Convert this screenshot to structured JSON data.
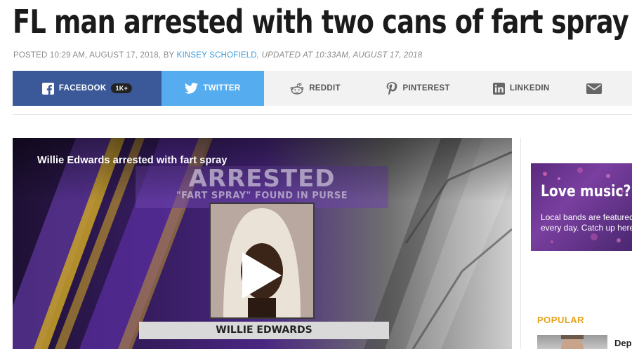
{
  "article": {
    "headline": "FL man arrested with two cans of fart spray",
    "byline_prefix": "POSTED 10:29 AM, AUGUST 17, 2018, BY ",
    "author": "KINSEY SCHOFIELD",
    "updated": ", UPDATED AT 10:33AM, AUGUST 17, 2018"
  },
  "share": {
    "facebook": {
      "label": "FACEBOOK",
      "count": "1K+",
      "icon": "facebook-icon",
      "color": "#3b5998"
    },
    "twitter": {
      "label": "TWITTER",
      "icon": "twitter-icon",
      "color": "#55acee"
    },
    "reddit": {
      "label": "REDDIT",
      "icon": "reddit-icon"
    },
    "pinterest": {
      "label": "PINTEREST",
      "icon": "pinterest-icon"
    },
    "linkedin": {
      "label": "LINKEDIN",
      "icon": "linkedin-icon"
    },
    "email": {
      "icon": "email-icon"
    }
  },
  "video": {
    "title": "Willie Edwards arrested with fart spray",
    "graphic_headline": "ARRESTED",
    "graphic_subhead": "\"FART SPRAY\" FOUND IN PURSE",
    "name_caption": "WILLIE EDWARDS",
    "play_icon": "play-icon"
  },
  "sidebar": {
    "ad": {
      "title": "Love music?",
      "body": "Local bands are featured every day. Catch up here!"
    },
    "popular": {
      "heading": "POPULAR",
      "first_item_title": "Depu"
    }
  },
  "colors": {
    "accent_orange": "#e8a31b",
    "link_blue": "#3a9ad9"
  }
}
